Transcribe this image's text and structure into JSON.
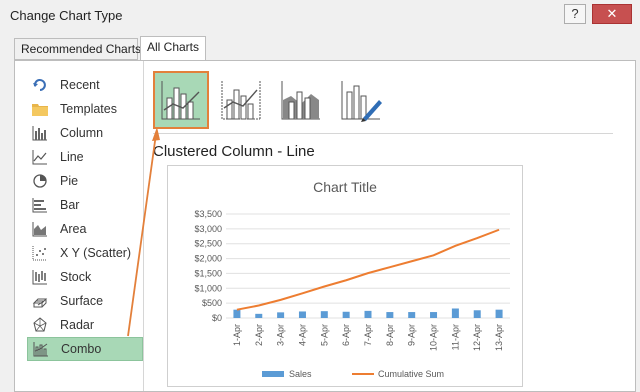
{
  "window": {
    "title": "Change Chart Type",
    "help_label": "?",
    "close_label": "✕"
  },
  "tabs": [
    {
      "label": "Recommended Charts"
    },
    {
      "label": "All Charts"
    }
  ],
  "sidebar": {
    "items": [
      {
        "label": "Recent",
        "icon": "recent-icon"
      },
      {
        "label": "Templates",
        "icon": "folder-icon"
      },
      {
        "label": "Column",
        "icon": "column-chart-icon"
      },
      {
        "label": "Line",
        "icon": "line-chart-icon"
      },
      {
        "label": "Pie",
        "icon": "pie-chart-icon"
      },
      {
        "label": "Bar",
        "icon": "bar-chart-icon"
      },
      {
        "label": "Area",
        "icon": "area-chart-icon"
      },
      {
        "label": "X Y (Scatter)",
        "icon": "scatter-chart-icon"
      },
      {
        "label": "Stock",
        "icon": "stock-chart-icon"
      },
      {
        "label": "Surface",
        "icon": "surface-chart-icon"
      },
      {
        "label": "Radar",
        "icon": "radar-chart-icon"
      },
      {
        "label": "Combo",
        "icon": "combo-chart-icon",
        "selected": true
      }
    ]
  },
  "subtypes": {
    "selected_name": "Clustered Column - Line",
    "items": [
      "clustered-column-line",
      "clustered-column-line-secondary-axis",
      "stacked-area-clustered-column",
      "custom-combination"
    ]
  },
  "colors": {
    "accent_green": "#a8d8b6",
    "arrow_orange": "#e3803b",
    "series_sales": "#5b9bd5",
    "series_cumulative": "#ed7d31"
  },
  "chart_data": {
    "type": "bar",
    "title": "Chart Title",
    "categories": [
      "1-Apr",
      "2-Apr",
      "3-Apr",
      "4-Apr",
      "5-Apr",
      "6-Apr",
      "7-Apr",
      "8-Apr",
      "9-Apr",
      "10-Apr",
      "11-Apr",
      "12-Apr",
      "13-Apr"
    ],
    "series": [
      {
        "name": "Sales",
        "type": "bar",
        "values": [
          280,
          140,
          190,
          220,
          230,
          210,
          240,
          200,
          200,
          200,
          320,
          260,
          280
        ]
      },
      {
        "name": "Cumulative Sum",
        "type": "line",
        "values": [
          280,
          420,
          610,
          830,
          1060,
          1270,
          1510,
          1710,
          1910,
          2110,
          2430,
          2690,
          2970
        ]
      }
    ],
    "ylim": [
      0,
      3500
    ],
    "y_ticks": [
      "$0",
      "$500",
      "$1,000",
      "$1,500",
      "$2,000",
      "$2,500",
      "$3,000",
      "$3,500"
    ],
    "grid": true,
    "legend_position": "bottom"
  }
}
